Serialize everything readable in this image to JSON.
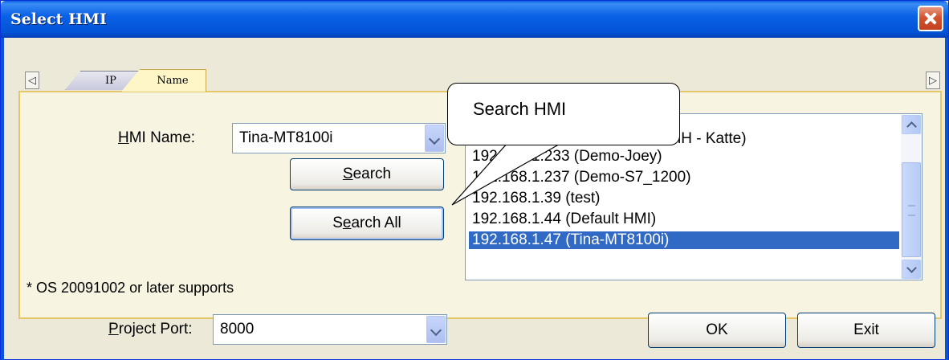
{
  "window": {
    "title": "Select HMI"
  },
  "tabs": [
    {
      "label": "IP"
    },
    {
      "label": "Name"
    }
  ],
  "hmi_name": {
    "label_prefix": "",
    "label_accel": "H",
    "label_rest": "MI Name:",
    "value": "Tina-MT8100i"
  },
  "buttons": {
    "search_accel": "S",
    "search_rest": "earch",
    "search_all_pre": "S",
    "search_all_accel": "e",
    "search_all_rest": "arch All",
    "ok": "OK",
    "exit": "Exit"
  },
  "note": "* OS 20091002 or later supports",
  "hmi_list": [
    {
      "text": "iH - Katte)"
    },
    {
      "text": "192.168.1.233 (Demo-Joey)"
    },
    {
      "text": "192.168.1.237 (Demo-S7_1200)"
    },
    {
      "text": "192.168.1.39 (test)"
    },
    {
      "text": "192.168.1.44 (Default HMI)"
    },
    {
      "text": "192.168.1.47 (Tina-MT8100i)"
    }
  ],
  "selected_index": 5,
  "callout": {
    "text": "Search HMI"
  },
  "project_port": {
    "label_accel": "P",
    "label_rest": "roject Port:",
    "value": "8000"
  },
  "colors": {
    "title_bar": "#0a5ee0",
    "selection": "#316ac5",
    "tab_active": "#fff6c8"
  }
}
